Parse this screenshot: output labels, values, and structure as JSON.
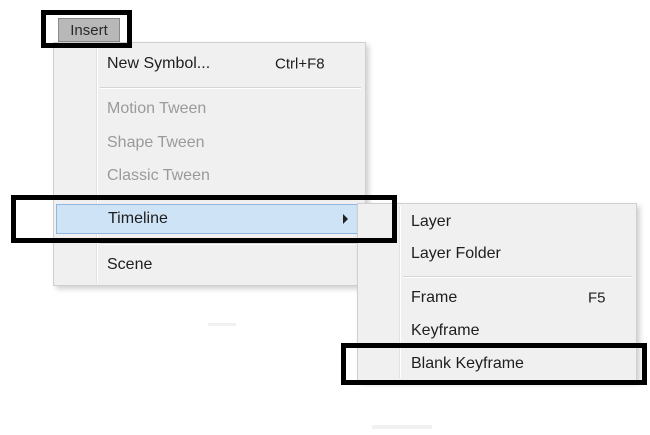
{
  "menubar": {
    "insert_label": "Insert"
  },
  "insert_menu": {
    "items": [
      {
        "label": "New Symbol...",
        "shortcut": "Ctrl+F8",
        "enabled": true
      },
      {
        "label": "Motion Tween",
        "enabled": false
      },
      {
        "label": "Shape Tween",
        "enabled": false
      },
      {
        "label": "Classic Tween",
        "enabled": false
      },
      {
        "label": "Timeline",
        "enabled": true,
        "highlighted": true,
        "has_submenu": true,
        "arrow_icon": "chevron-right-icon"
      },
      {
        "label": "Scene",
        "enabled": true
      }
    ]
  },
  "timeline_submenu": {
    "items": [
      {
        "label": "Layer",
        "enabled": true
      },
      {
        "label": "Layer Folder",
        "enabled": true
      },
      {
        "label": "Frame",
        "shortcut": "F5",
        "enabled": true
      },
      {
        "label": "Keyframe",
        "enabled": true
      },
      {
        "label": "Blank Keyframe",
        "enabled": true
      }
    ]
  },
  "colors": {
    "menu_background": "#f0f0f0",
    "highlight_background": "#cfe3f7",
    "highlight_border": "#8fb6e0",
    "disabled_text": "#9a9a9a",
    "annotation_border": "#000000"
  }
}
